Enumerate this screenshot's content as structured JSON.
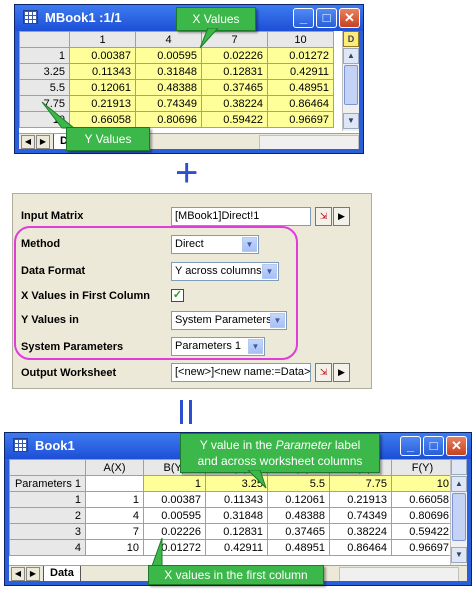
{
  "matrix_window": {
    "title": "MBook1 :1/1",
    "col_headers": [
      "",
      "1",
      "4",
      "7",
      "10"
    ],
    "rows": [
      [
        "1",
        "0.00387",
        "0.00595",
        "0.02226",
        "0.01272"
      ],
      [
        "3.25",
        "0.11343",
        "0.31848",
        "0.12831",
        "0.42911"
      ],
      [
        "5.5",
        "0.12061",
        "0.48388",
        "0.37465",
        "0.48951"
      ],
      [
        "7.75",
        "0.21913",
        "0.74349",
        "0.38224",
        "0.86464"
      ],
      [
        "10",
        "0.66058",
        "0.80696",
        "0.59422",
        "0.96697"
      ]
    ],
    "tab_label": "D",
    "corner_badge": "D"
  },
  "callouts": {
    "x_values": "X Values",
    "y_values": "Y Values",
    "param_label_line1_a": "Y value in the ",
    "param_label_line1_b": "Parameter",
    "param_label_line1_c": " label",
    "param_label_line2": "and across worksheet columns",
    "first_column": "X values in the first column"
  },
  "symbols": {
    "plus": "+"
  },
  "dialog": {
    "input_matrix_label": "Input Matrix",
    "input_matrix_value": "[MBook1]Direct!1",
    "method_label": "Method",
    "method_value": "Direct",
    "data_format_label": "Data Format",
    "data_format_value": "Y across columns",
    "x_first_col_label": "X Values in First Column",
    "x_first_col_checked": "✓",
    "y_values_label": "Y Values in",
    "y_values_value": "System Parameters",
    "sys_params_label": "System Parameters",
    "sys_params_value": "Parameters 1",
    "output_label": "Output Worksheet",
    "output_value": "[<new>]<new name:=Data>"
  },
  "book_window": {
    "title": "Book1",
    "col_headers": [
      "",
      "A(X)",
      "B(Y)",
      "C(Y)",
      "D(Y)",
      "E(Y)",
      "F(Y)"
    ],
    "param_row": [
      "Parameters 1",
      "",
      "1",
      "3.25",
      "5.5",
      "7.75",
      "10"
    ],
    "rows": [
      [
        "1",
        "1",
        "0.00387",
        "0.11343",
        "0.12061",
        "0.21913",
        "0.66058"
      ],
      [
        "2",
        "4",
        "0.00595",
        "0.31848",
        "0.48388",
        "0.74349",
        "0.80696"
      ],
      [
        "3",
        "7",
        "0.02226",
        "0.12831",
        "0.37465",
        "0.38224",
        "0.59422"
      ],
      [
        "4",
        "10",
        "0.01272",
        "0.42911",
        "0.48951",
        "0.86464",
        "0.96697"
      ]
    ],
    "tab_label": "Data"
  },
  "colors": {
    "callout_green": "#3cb84a",
    "highlight_magenta": "#e23bd9",
    "cell_yellow": "#ffff99",
    "accent_blue": "#2b4fd0"
  }
}
